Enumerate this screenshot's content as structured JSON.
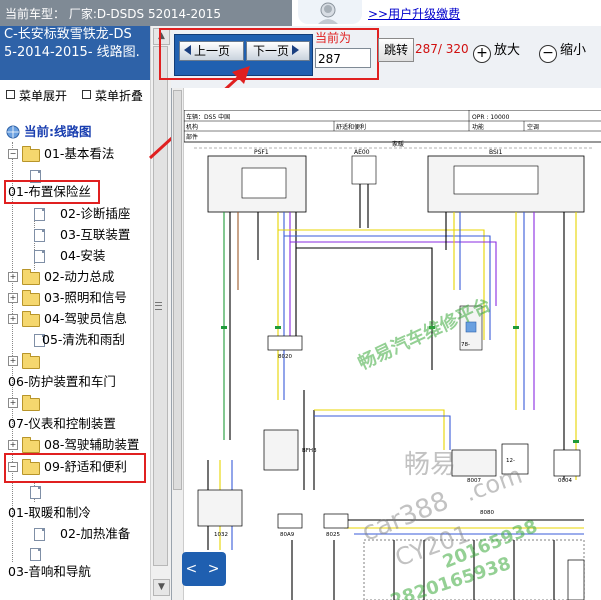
{
  "top_bar": {
    "text": "当前车型： 厂家:D-DSDS 52014-2015"
  },
  "ad": {
    "link": ">>用户升级缴费"
  },
  "left_panel": {
    "title": "C-长安标致雪铁龙-DS 5-2014-2015- 线路图.",
    "menu_expand": "菜单展开",
    "menu_collapse": "菜单折叠"
  },
  "tree": {
    "root": "当前:线路图",
    "n1": "01-基本看法",
    "n2": "01-布置保险丝",
    "n2a": "02-诊断插座",
    "n2b": "03-互联装置",
    "n2c": "04-安装",
    "n3": "02-动力总成",
    "n4": "03-照明和信号",
    "n5": "04-驾驶员信息",
    "n5a": "05-清洗和雨刮",
    "n6": "06-防护装置和车门",
    "n7": "07-仪表和控制装置",
    "n8": "08-驾驶辅助装置",
    "n9": "09-舒适和便利",
    "n10": "01-取暖和制冷",
    "n10a": "02-加热准备",
    "n11": "03-音响和导航"
  },
  "toolbar": {
    "prev_label": "上一页",
    "next_label": "下一页",
    "current_label": "当前为",
    "page_value": "287",
    "jump_label": "跳转",
    "page_count": "287/ 320",
    "zoom_in": "放大",
    "zoom_out": "缩小"
  },
  "diagram": {
    "header_row1_left": "车辆：DS5 中国",
    "header_row1_right": "OPR : 10000",
    "header_row2_a": "舒适和便利",
    "header_row2_b": "功能",
    "header_row2_c": "空调",
    "header_row2_label_1": "机构",
    "header_row3_label": "部件",
    "center_label": "家暖",
    "comp_psf1": "PSF1",
    "comp_ae00": "AE00",
    "comp_bsi1": "BSI1",
    "comp_8020": "8020",
    "comp_bfh3": "BFH3",
    "comp_8007": "8007",
    "comp_0004": "0004",
    "comp_8080": "8080",
    "comp_1032": "1032",
    "comp_80a9": "80A9",
    "comp_8025": "8025",
    "comp_78": "78-",
    "comp_12": "12-"
  },
  "watermarks": {
    "w1": "畅易汽车维修平台",
    "w2": "畅易",
    "w3": ".com",
    "w4": "car388",
    "w5": "CY201",
    "w6": "20165938",
    "w7": "2820165938"
  },
  "toggle": {
    "label": "< >"
  },
  "colors": {
    "title_blue": "#2e62a8",
    "nav_blue": "#2060b0",
    "highlight_red": "#e02020",
    "wire_yellow": "#e8d400",
    "wire_blue": "#3a5bd8",
    "wire_purple": "#8a2be2",
    "wire_green": "#1f9a3a",
    "wire_brown": "#9a5a2a"
  },
  "icons": [
    "user-avatar-icon",
    "menu-square-icon",
    "globe-icon",
    "folder-icon",
    "document-icon",
    "expand-icon",
    "collapse-icon",
    "arrow-left-icon",
    "arrow-right-icon",
    "zoom-in-icon",
    "zoom-out-icon"
  ]
}
